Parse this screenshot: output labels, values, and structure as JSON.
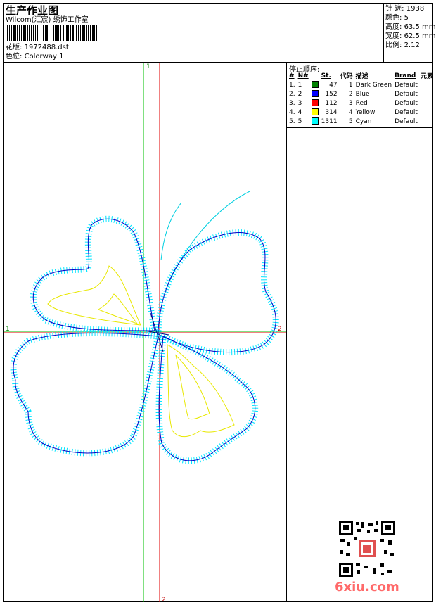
{
  "header": {
    "title": "生产作业图",
    "studio": "Wilcom(汇宸) 绣饰工作室",
    "design_label": "花版:",
    "design_value": "1972488.dst",
    "color_label": "色位:",
    "color_value": "Colorway 1"
  },
  "stats": {
    "stitches_label": "针 迹:",
    "stitches": "1938",
    "colors_label": "颜色:",
    "colors": "5",
    "height_label": "高度:",
    "height": "63.5 mm",
    "width_label": "宽度:",
    "width": "62.5 mm",
    "ratio_label": "比例:",
    "ratio": "2.12"
  },
  "sequence": {
    "title": "停止顺序:",
    "columns": [
      "#",
      "N#",
      "St.",
      "代码",
      "描述",
      "Brand",
      "元素"
    ],
    "rows": [
      {
        "idx": "1.",
        "n": "1",
        "color": "#008000",
        "st": "47",
        "code": "1",
        "desc": "Dark Green",
        "brand": "Default"
      },
      {
        "idx": "2.",
        "n": "2",
        "color": "#0000ff",
        "st": "152",
        "code": "2",
        "desc": "Blue",
        "brand": "Default"
      },
      {
        "idx": "3.",
        "n": "3",
        "color": "#ff0000",
        "st": "112",
        "code": "3",
        "desc": "Red",
        "brand": "Default"
      },
      {
        "idx": "4.",
        "n": "4",
        "color": "#ffff00",
        "st": "314",
        "code": "4",
        "desc": "Yellow",
        "brand": "Default"
      },
      {
        "idx": "5.",
        "n": "5",
        "color": "#00ffff",
        "st": "1311",
        "code": "5",
        "desc": "Cyan",
        "brand": "Default"
      }
    ]
  },
  "axes": {
    "top_label": "1",
    "left_label": "1",
    "right_label": "2",
    "bottom_label": "2"
  },
  "watermark": {
    "site": "6xiu.com"
  }
}
